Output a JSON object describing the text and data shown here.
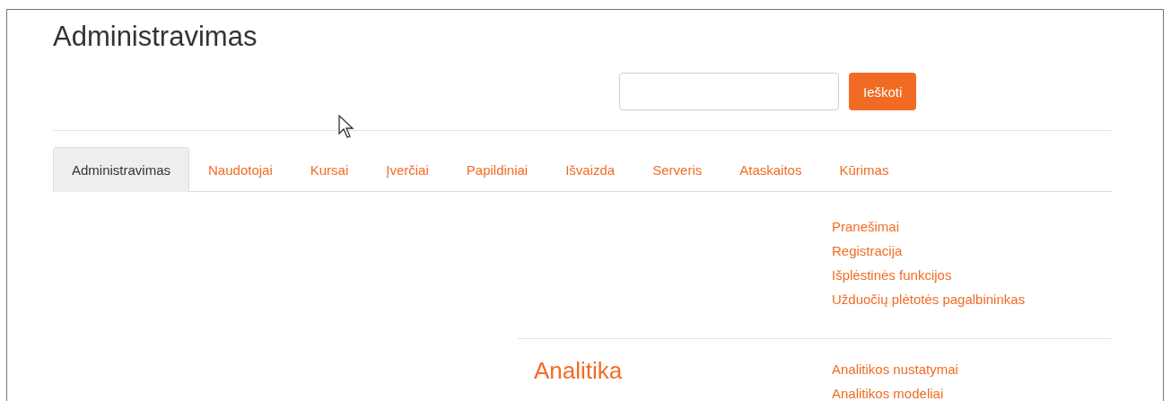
{
  "page_title": "Administravimas",
  "search": {
    "button": "Ieškoti"
  },
  "tabs": [
    {
      "label": "Administravimas",
      "selected": true
    },
    {
      "label": "Naudotojai",
      "selected": false
    },
    {
      "label": "Kursai",
      "selected": false
    },
    {
      "label": "Įverčiai",
      "selected": false
    },
    {
      "label": "Papildiniai",
      "selected": false
    },
    {
      "label": "Išvaizda",
      "selected": false
    },
    {
      "label": "Serveris",
      "selected": false
    },
    {
      "label": "Ataskaitos",
      "selected": false
    },
    {
      "label": "Kūrimas",
      "selected": false
    }
  ],
  "sections": [
    {
      "links": [
        "Pranešimai",
        "Registracija",
        "Išplėstinės funkcijos",
        "Užduočių plėtotės pagalbininkas"
      ]
    },
    {
      "heading": "Analitika",
      "links": [
        "Analitikos nustatymai",
        "Analitikos modeliai"
      ]
    }
  ]
}
